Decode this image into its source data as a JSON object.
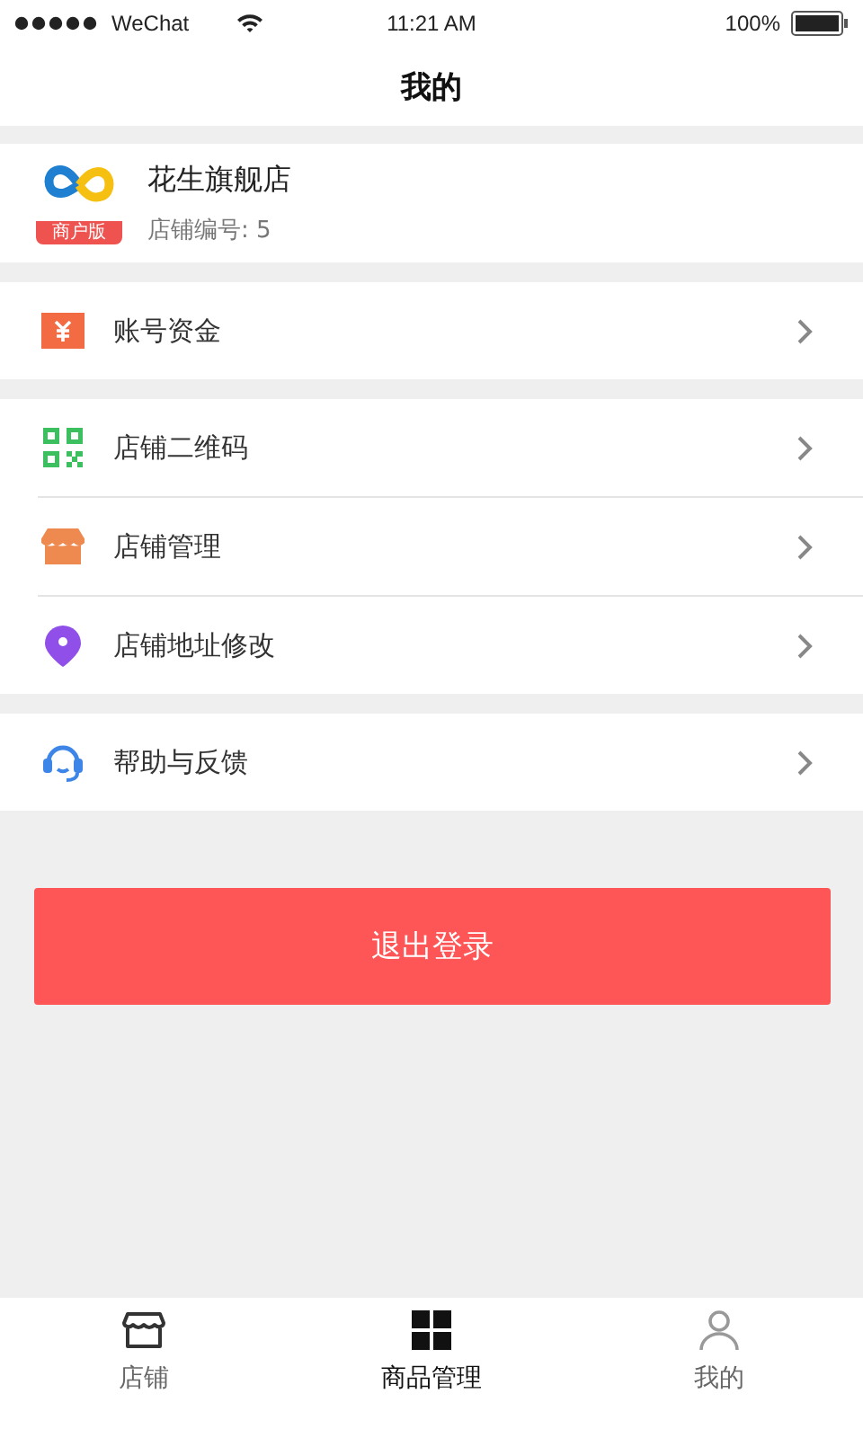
{
  "status_bar": {
    "carrier": "WeChat",
    "time": "11:21 AM",
    "battery": "100%"
  },
  "nav": {
    "title": "我的"
  },
  "store": {
    "badge": "商户版",
    "name": "花生旗舰店",
    "number": "店铺编号: 5"
  },
  "menu_groups": [
    [
      {
        "kind": "money",
        "label": "账号资金"
      }
    ],
    [
      {
        "kind": "qrcode",
        "label": "店铺二维码"
      },
      {
        "kind": "shop",
        "label": "店铺管理"
      },
      {
        "kind": "location",
        "label": "店铺地址修改"
      }
    ],
    [
      {
        "kind": "help",
        "label": "帮助与反馈"
      }
    ]
  ],
  "logout_button": "退出登录",
  "tab_bar": [
    {
      "kind": "shop",
      "label": "店铺",
      "selected": false
    },
    {
      "kind": "grid",
      "label": "商品管理",
      "selected": true
    },
    {
      "kind": "person",
      "label": "我的",
      "selected": false
    }
  ]
}
